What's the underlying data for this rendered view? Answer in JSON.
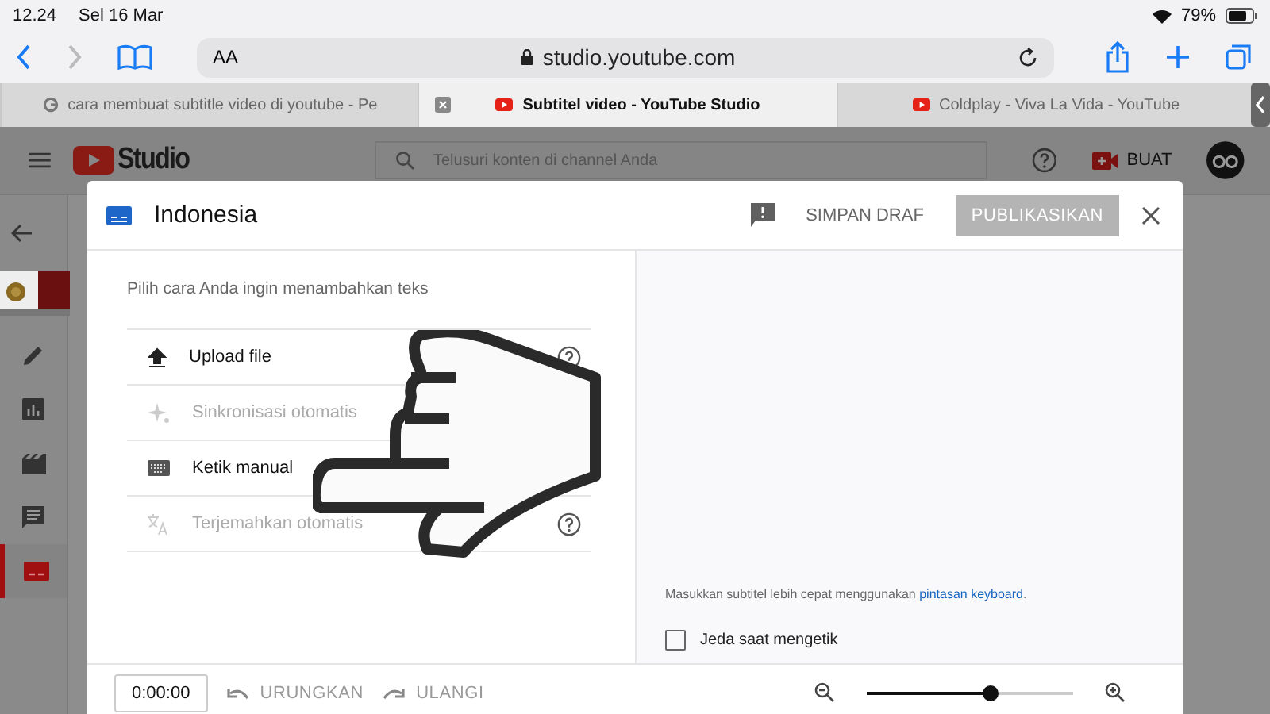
{
  "status_bar": {
    "time": "12.24",
    "date": "Sel 16 Mar",
    "battery": "79%"
  },
  "browser": {
    "text_size": "AA",
    "url": "studio.youtube.com",
    "tabs": [
      {
        "title": "cara membuat subtitle video di youtube - Pe",
        "selected": false,
        "kind": "google"
      },
      {
        "title": "Subtitel video - YouTube Studio",
        "selected": true,
        "kind": "youtube"
      },
      {
        "title": "Coldplay - Viva La Vida - YouTube",
        "selected": false,
        "kind": "youtube"
      }
    ]
  },
  "studio_header": {
    "logo": "Studio",
    "search": {
      "placeholder": "Telusuri konten di channel Anda"
    },
    "create_button": "BUAT"
  },
  "sidebar": {
    "items": [
      {
        "kind": "edit",
        "selected": false
      },
      {
        "kind": "analytics",
        "selected": false
      },
      {
        "kind": "editor",
        "selected": false
      },
      {
        "kind": "comments",
        "selected": false
      },
      {
        "kind": "subtitles",
        "selected": true
      }
    ]
  },
  "dialog": {
    "title": "Indonesia",
    "save_draft": "SIMPAN DRAF",
    "publish": {
      "label": "PUBLIKASIKAN",
      "disabled": true
    },
    "prompt": "Pilih cara Anda ingin menambahkan teks",
    "options": [
      {
        "kind": "upload",
        "label": "Upload file",
        "disabled": false,
        "help": true
      },
      {
        "kind": "sync",
        "label": "Sinkronisasi otomatis",
        "disabled": true,
        "help": false
      },
      {
        "kind": "keyboard",
        "label": "Ketik manual",
        "disabled": false,
        "help": false
      },
      {
        "kind": "translate",
        "label": "Terjemahkan otomatis",
        "disabled": true,
        "help": true
      }
    ],
    "hint": "Masukkan subtitel lebih cepat menggunakan",
    "hint_link": "pintasan keyboard",
    "hint_end": ".",
    "pause_checkbox": {
      "label": "Jeda saat mengetik",
      "checked": false
    },
    "timecode": "0:00:00",
    "undo": {
      "label": "URUNGKAN",
      "disabled": true
    },
    "redo": {
      "label": "ULANGI",
      "disabled": true
    },
    "zoom": {
      "level": 0.6
    }
  }
}
